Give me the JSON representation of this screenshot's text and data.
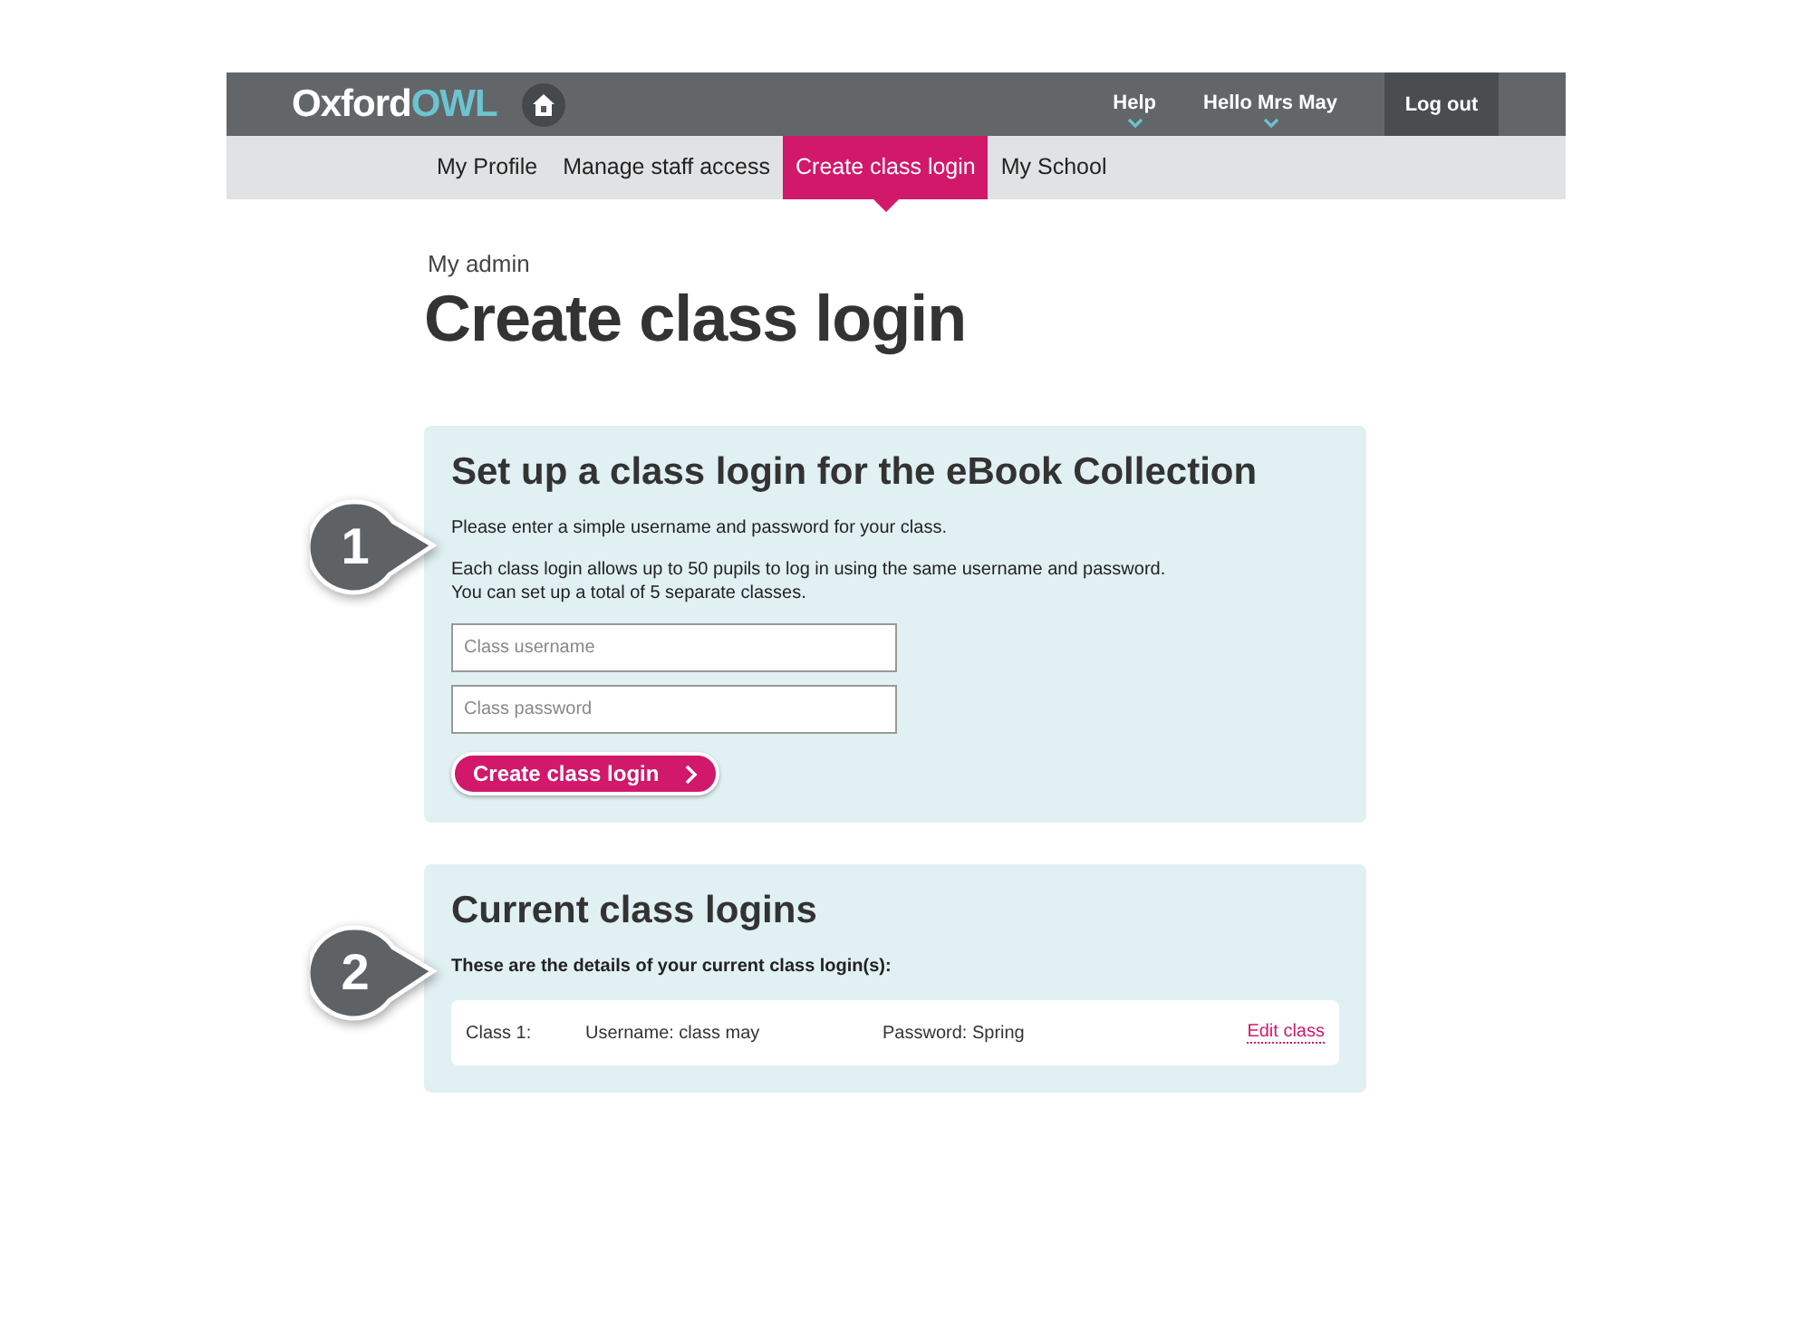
{
  "header": {
    "logo": {
      "first": "Oxford",
      "second": "OWL"
    },
    "menu": [
      {
        "label": "Help",
        "kind": "dropdown"
      },
      {
        "label": "Hello **Mrs May**",
        "kind": "dropdown"
      },
      {
        "label": "Log out",
        "kind": "button"
      }
    ]
  },
  "tabs": [
    {
      "label": "My Profile",
      "selected": false
    },
    {
      "label": "Manage staff access",
      "selected": false
    },
    {
      "label": "Create class login",
      "selected": true
    },
    {
      "label": "My School",
      "selected": false
    }
  ],
  "breadcrumb": "My admin",
  "title": "Create class login",
  "setup": {
    "callout": "1",
    "heading": "Set up a class login for the eBook Collection",
    "intro": "Please enter a simple username and password for your class.",
    "details": [
      "Each class login allows up to 50 pupils to log in using the same username and password.",
      "You can set up a total of 5 separate classes."
    ],
    "fields": [
      {
        "placeholder": "Class username"
      },
      {
        "placeholder": "Class password"
      }
    ],
    "button": "Create class login"
  },
  "current": {
    "callout": "2",
    "heading": "Current class logins",
    "intro": "These are the details of your current class login(s):",
    "rows": [
      {
        "class": "Class 1:",
        "username": "Username: class may",
        "password": "Password: Spring",
        "action": "Edit class"
      }
    ]
  }
}
